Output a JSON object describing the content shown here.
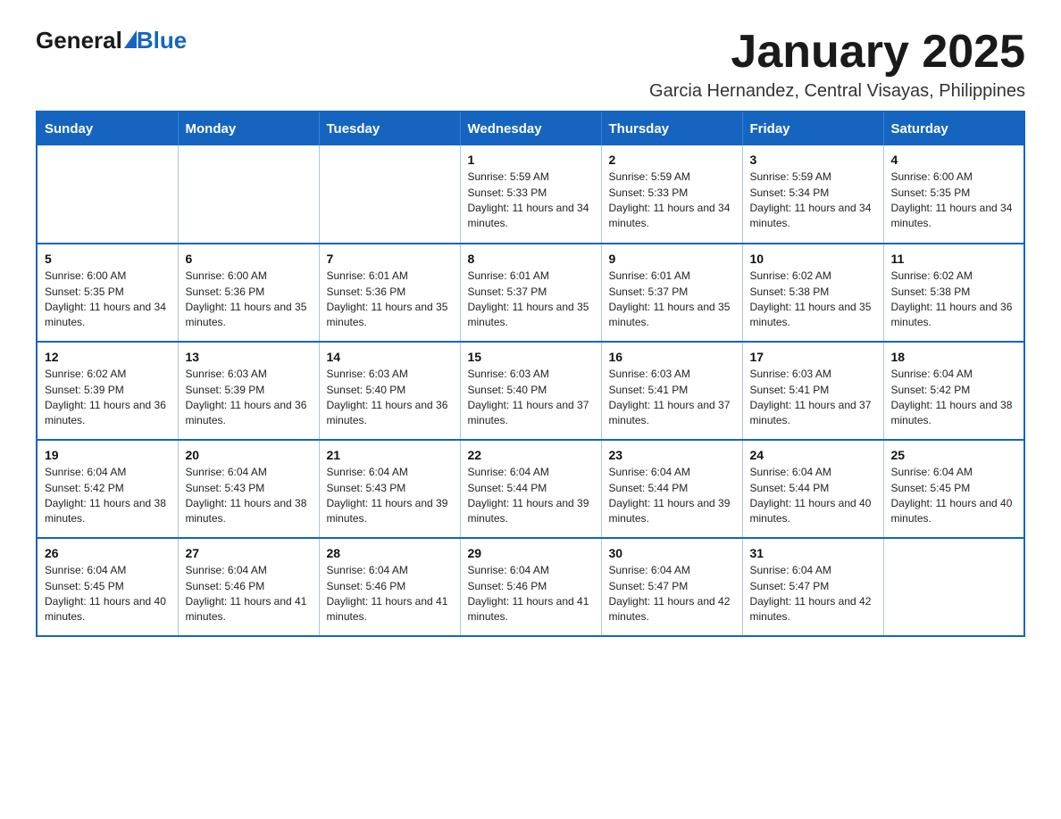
{
  "logo": {
    "general": "General",
    "blue": "Blue",
    "subtitle": ""
  },
  "header": {
    "month_year": "January 2025",
    "location": "Garcia Hernandez, Central Visayas, Philippines"
  },
  "days_of_week": [
    "Sunday",
    "Monday",
    "Tuesday",
    "Wednesday",
    "Thursday",
    "Friday",
    "Saturday"
  ],
  "weeks": [
    [
      {
        "day": "",
        "info": ""
      },
      {
        "day": "",
        "info": ""
      },
      {
        "day": "",
        "info": ""
      },
      {
        "day": "1",
        "info": "Sunrise: 5:59 AM\nSunset: 5:33 PM\nDaylight: 11 hours and 34 minutes."
      },
      {
        "day": "2",
        "info": "Sunrise: 5:59 AM\nSunset: 5:33 PM\nDaylight: 11 hours and 34 minutes."
      },
      {
        "day": "3",
        "info": "Sunrise: 5:59 AM\nSunset: 5:34 PM\nDaylight: 11 hours and 34 minutes."
      },
      {
        "day": "4",
        "info": "Sunrise: 6:00 AM\nSunset: 5:35 PM\nDaylight: 11 hours and 34 minutes."
      }
    ],
    [
      {
        "day": "5",
        "info": "Sunrise: 6:00 AM\nSunset: 5:35 PM\nDaylight: 11 hours and 34 minutes."
      },
      {
        "day": "6",
        "info": "Sunrise: 6:00 AM\nSunset: 5:36 PM\nDaylight: 11 hours and 35 minutes."
      },
      {
        "day": "7",
        "info": "Sunrise: 6:01 AM\nSunset: 5:36 PM\nDaylight: 11 hours and 35 minutes."
      },
      {
        "day": "8",
        "info": "Sunrise: 6:01 AM\nSunset: 5:37 PM\nDaylight: 11 hours and 35 minutes."
      },
      {
        "day": "9",
        "info": "Sunrise: 6:01 AM\nSunset: 5:37 PM\nDaylight: 11 hours and 35 minutes."
      },
      {
        "day": "10",
        "info": "Sunrise: 6:02 AM\nSunset: 5:38 PM\nDaylight: 11 hours and 35 minutes."
      },
      {
        "day": "11",
        "info": "Sunrise: 6:02 AM\nSunset: 5:38 PM\nDaylight: 11 hours and 36 minutes."
      }
    ],
    [
      {
        "day": "12",
        "info": "Sunrise: 6:02 AM\nSunset: 5:39 PM\nDaylight: 11 hours and 36 minutes."
      },
      {
        "day": "13",
        "info": "Sunrise: 6:03 AM\nSunset: 5:39 PM\nDaylight: 11 hours and 36 minutes."
      },
      {
        "day": "14",
        "info": "Sunrise: 6:03 AM\nSunset: 5:40 PM\nDaylight: 11 hours and 36 minutes."
      },
      {
        "day": "15",
        "info": "Sunrise: 6:03 AM\nSunset: 5:40 PM\nDaylight: 11 hours and 37 minutes."
      },
      {
        "day": "16",
        "info": "Sunrise: 6:03 AM\nSunset: 5:41 PM\nDaylight: 11 hours and 37 minutes."
      },
      {
        "day": "17",
        "info": "Sunrise: 6:03 AM\nSunset: 5:41 PM\nDaylight: 11 hours and 37 minutes."
      },
      {
        "day": "18",
        "info": "Sunrise: 6:04 AM\nSunset: 5:42 PM\nDaylight: 11 hours and 38 minutes."
      }
    ],
    [
      {
        "day": "19",
        "info": "Sunrise: 6:04 AM\nSunset: 5:42 PM\nDaylight: 11 hours and 38 minutes."
      },
      {
        "day": "20",
        "info": "Sunrise: 6:04 AM\nSunset: 5:43 PM\nDaylight: 11 hours and 38 minutes."
      },
      {
        "day": "21",
        "info": "Sunrise: 6:04 AM\nSunset: 5:43 PM\nDaylight: 11 hours and 39 minutes."
      },
      {
        "day": "22",
        "info": "Sunrise: 6:04 AM\nSunset: 5:44 PM\nDaylight: 11 hours and 39 minutes."
      },
      {
        "day": "23",
        "info": "Sunrise: 6:04 AM\nSunset: 5:44 PM\nDaylight: 11 hours and 39 minutes."
      },
      {
        "day": "24",
        "info": "Sunrise: 6:04 AM\nSunset: 5:44 PM\nDaylight: 11 hours and 40 minutes."
      },
      {
        "day": "25",
        "info": "Sunrise: 6:04 AM\nSunset: 5:45 PM\nDaylight: 11 hours and 40 minutes."
      }
    ],
    [
      {
        "day": "26",
        "info": "Sunrise: 6:04 AM\nSunset: 5:45 PM\nDaylight: 11 hours and 40 minutes."
      },
      {
        "day": "27",
        "info": "Sunrise: 6:04 AM\nSunset: 5:46 PM\nDaylight: 11 hours and 41 minutes."
      },
      {
        "day": "28",
        "info": "Sunrise: 6:04 AM\nSunset: 5:46 PM\nDaylight: 11 hours and 41 minutes."
      },
      {
        "day": "29",
        "info": "Sunrise: 6:04 AM\nSunset: 5:46 PM\nDaylight: 11 hours and 41 minutes."
      },
      {
        "day": "30",
        "info": "Sunrise: 6:04 AM\nSunset: 5:47 PM\nDaylight: 11 hours and 42 minutes."
      },
      {
        "day": "31",
        "info": "Sunrise: 6:04 AM\nSunset: 5:47 PM\nDaylight: 11 hours and 42 minutes."
      },
      {
        "day": "",
        "info": ""
      }
    ]
  ]
}
